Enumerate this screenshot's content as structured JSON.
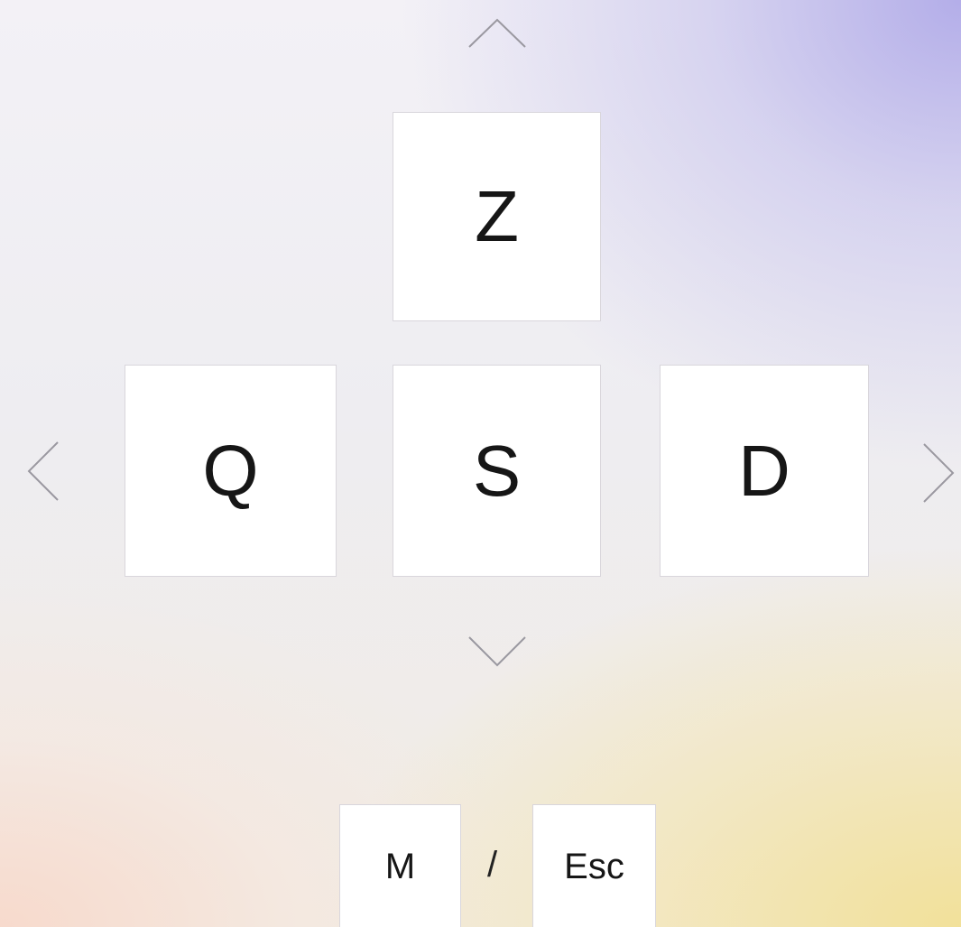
{
  "controls": {
    "up_icon": "chevron-up-icon",
    "down_icon": "chevron-down-icon",
    "left_icon": "chevron-left-icon",
    "right_icon": "chevron-right-icon",
    "arrow_color": "#9a98a0",
    "keys": {
      "up": "Z",
      "left": "Q",
      "down": "S",
      "right": "D"
    }
  },
  "menu_hint": {
    "key_menu": "M",
    "separator": "/",
    "key_escape": "Esc"
  }
}
